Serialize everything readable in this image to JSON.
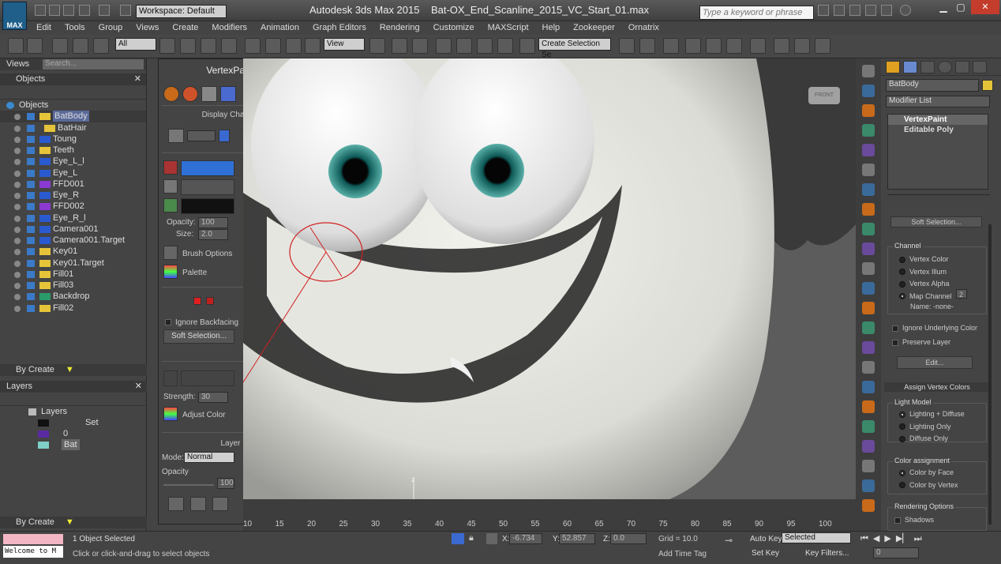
{
  "app": {
    "logo": "MAX",
    "workspace": "Workspace: Default",
    "title": "Autodesk 3ds Max  2015",
    "filename": "Bat-OX_End_Scanline_2015_VC_Start_01.max",
    "search_placeholder": "Type a keyword or phrase"
  },
  "menu": [
    "Edit",
    "Tools",
    "Group",
    "Views",
    "Create",
    "Modifiers",
    "Animation",
    "Graph Editors",
    "Rendering",
    "Customize",
    "MAXScript",
    "Help",
    "Zookeeper",
    "Ornatrix"
  ],
  "toolbar": {
    "selection_filter": "All",
    "ref_coord": "View",
    "named_selection": "Create Selection Se"
  },
  "explorer": {
    "views_label": "Views",
    "search_placeholder": "Search...",
    "objects_title": "Objects",
    "root": "Objects",
    "items": [
      {
        "name": "BatBody",
        "color": "#e6c43a"
      },
      {
        "name": "BatHair",
        "color": "#e6c43a"
      },
      {
        "name": "Toung",
        "color": "#2a5ad0"
      },
      {
        "name": "Teeth",
        "color": "#e6c43a"
      },
      {
        "name": "Eye_L_l",
        "color": "#2a5ad0"
      },
      {
        "name": "Eye_L",
        "color": "#2a5ad0"
      },
      {
        "name": "FFD001",
        "color": "#8a3ad0"
      },
      {
        "name": "Eye_R",
        "color": "#2a5ad0"
      },
      {
        "name": "FFD002",
        "color": "#8a3ad0"
      },
      {
        "name": "Eye_R_l",
        "color": "#2a5ad0"
      },
      {
        "name": "Camera001",
        "color": "#2a5ad0"
      },
      {
        "name": "Camera001.Target",
        "color": "#2a5ad0"
      },
      {
        "name": "Key01",
        "color": "#e6c43a"
      },
      {
        "name": "Key01.Target",
        "color": "#e6c43a"
      },
      {
        "name": "Fill01",
        "color": "#e6c43a"
      },
      {
        "name": "Fill03",
        "color": "#e6c43a"
      },
      {
        "name": "Backdrop",
        "color": "#2a9a6a"
      },
      {
        "name": "Fill02",
        "color": "#e6c43a"
      }
    ],
    "by_create": "By Create",
    "layers_title": "Layers",
    "layers": [
      {
        "name": "Layers"
      },
      {
        "name": "0"
      },
      {
        "name": "Bat"
      }
    ],
    "layer_set": "Set",
    "by_create2": "By Create"
  },
  "vertexpaint": {
    "title": "VertexPaint",
    "display_channel": "Display Channel",
    "opacity_label": "Opacity:",
    "opacity_value": "100",
    "size_label": "Size:",
    "size_value": "2.0",
    "brush_options": "Brush Options",
    "palette": "Palette",
    "ignore_backfacing": "Ignore Backfacing",
    "soft_selection": "Soft Selection...",
    "strength_label": "Strength:",
    "strength_value": "30",
    "adjust_color": "Adjust Color",
    "layer_title": "Layer",
    "mode_label": "Mode:",
    "mode_value": "Normal",
    "opacity_title": "Opacity",
    "layer_opacity_value": "100",
    "paint_color": "#2f70d6"
  },
  "viewport": {
    "viewcube": "FRONT",
    "axis": "z"
  },
  "timeline": {
    "ticks": [
      "10",
      "15",
      "20",
      "25",
      "30",
      "35",
      "40",
      "45",
      "50",
      "55",
      "60",
      "65",
      "70",
      "75",
      "80",
      "85",
      "90",
      "95",
      "100"
    ]
  },
  "command_panel": {
    "object_name": "BatBody",
    "modifier_list": "Modifier List",
    "stack": [
      "VertexPaint",
      "Editable Poly"
    ],
    "soft_selection_btn": "Soft Selection...",
    "channel_title": "Channel",
    "channels": [
      {
        "label": "Vertex Color",
        "on": false
      },
      {
        "label": "Vertex Illum",
        "on": false
      },
      {
        "label": "Vertex Alpha",
        "on": false
      },
      {
        "label": "Map Channel",
        "on": true
      }
    ],
    "map_channel_value": "2",
    "name_label": "Name: -none-",
    "ignore_underlying": "Ignore Underlying Color",
    "preserve_layer": "Preserve Layer",
    "edit_btn": "Edit...",
    "assign_title": "Assign Vertex Colors",
    "light_model": "Light Model",
    "light_options": [
      {
        "label": "Lighting + Diffuse",
        "on": true
      },
      {
        "label": "Lighting Only",
        "on": false
      },
      {
        "label": "Diffuse Only",
        "on": false
      }
    ],
    "color_assign": "Color assignment",
    "color_options": [
      {
        "label": "Color by Face",
        "on": true
      },
      {
        "label": "Color by Vertex",
        "on": false
      }
    ],
    "render_options": "Rendering Options",
    "shadows": "Shadows"
  },
  "status": {
    "welcome": "Welcome to M",
    "selected": "1 Object Selected",
    "hint": "Click or click-and-drag to select objects",
    "x_label": "X:",
    "x_value": "-6.734",
    "y_label": "Y:",
    "y_value": "52.857",
    "z_label": "Z:",
    "z_value": "0.0",
    "grid": "Grid = 10.0",
    "add_time_tag": "Add Time Tag",
    "auto_key": "Auto Key",
    "set_key": "Set Key",
    "key_mode": "Selected",
    "key_filters": "Key Filters...",
    "frame": "0"
  }
}
